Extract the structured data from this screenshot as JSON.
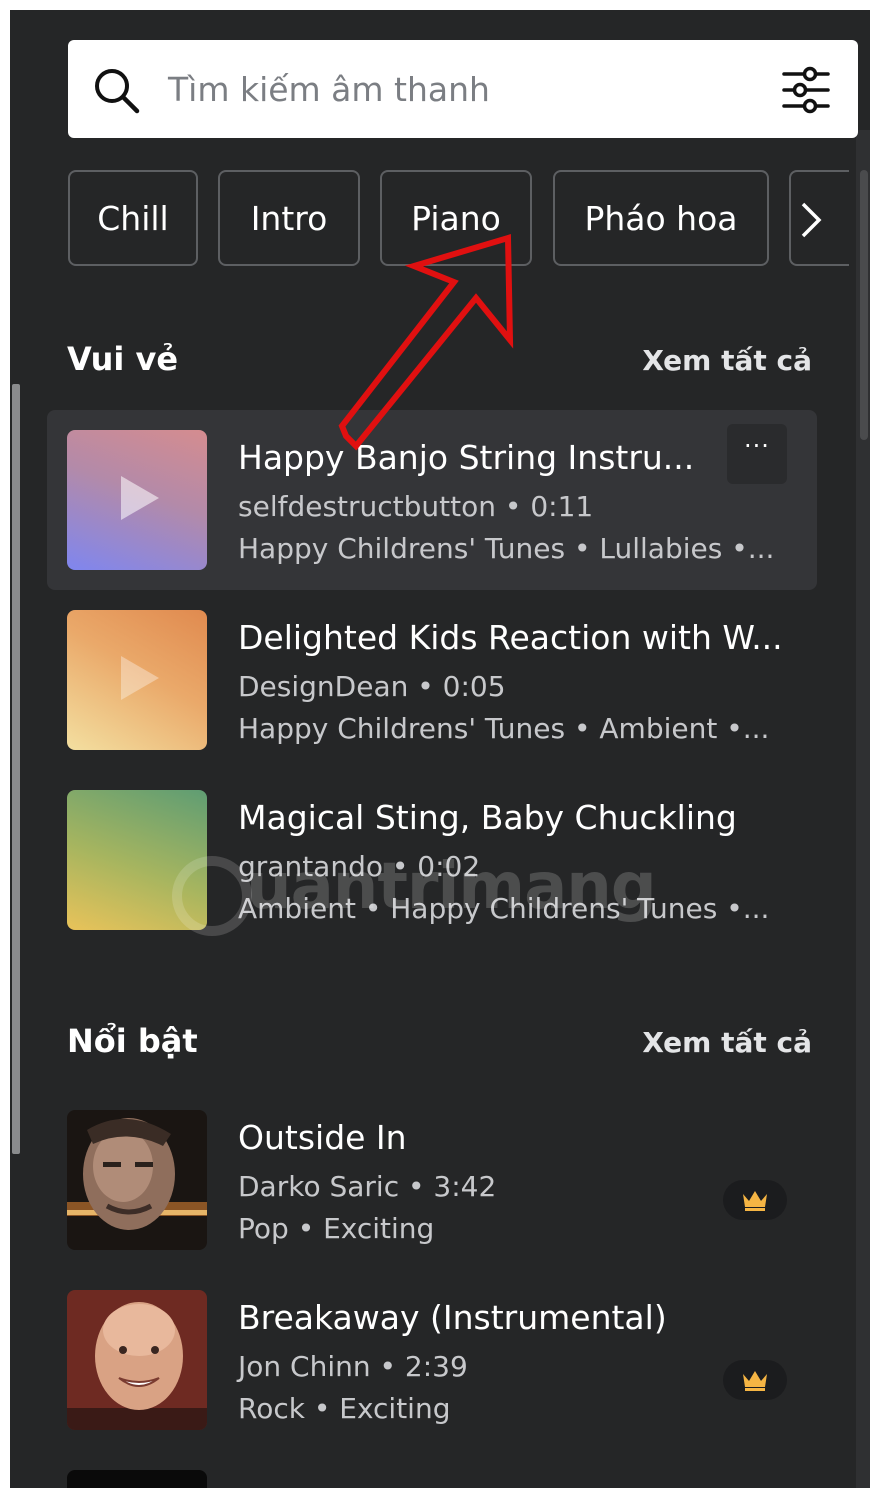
{
  "search": {
    "placeholder": "Tìm kiếm âm thanh"
  },
  "chips": [
    "Chill",
    "Intro",
    "Piano",
    "Pháo hoa"
  ],
  "sections": [
    {
      "title": "Vui vẻ",
      "see_all": "Xem tất cả",
      "tracks": [
        {
          "title": "Happy Banjo String Instru...",
          "meta": "selfdestructbutton • 0:11",
          "tags": "Happy Childrens' Tunes • Lullabies •...",
          "more": "···"
        },
        {
          "title": "Delighted Kids Reaction with W...",
          "meta": "DesignDean • 0:05",
          "tags": "Happy Childrens' Tunes • Ambient •..."
        },
        {
          "title": "Magical Sting, Baby Chuckling",
          "meta": "grantando • 0:02",
          "tags": "Ambient • Happy Childrens' Tunes •..."
        }
      ]
    },
    {
      "title": "Nổi bật",
      "see_all": "Xem tất cả",
      "tracks": [
        {
          "title": "Outside In",
          "meta": "Darko Saric • 3:42",
          "tags": "Pop • Exciting"
        },
        {
          "title": "Breakaway (Instrumental)",
          "meta": "Jon Chinn • 2:39",
          "tags": "Rock • Exciting"
        }
      ]
    }
  ],
  "watermark": "uantrimang",
  "icons": {
    "search": "search-icon",
    "filter": "filter-sliders-icon",
    "next": "chevron-right-icon",
    "premium": "crown-icon",
    "play": "play-icon"
  },
  "colors": {
    "background": "#252627",
    "active_row": "#343538",
    "crown": "#f5b544",
    "annotation_arrow": "#e01010"
  }
}
